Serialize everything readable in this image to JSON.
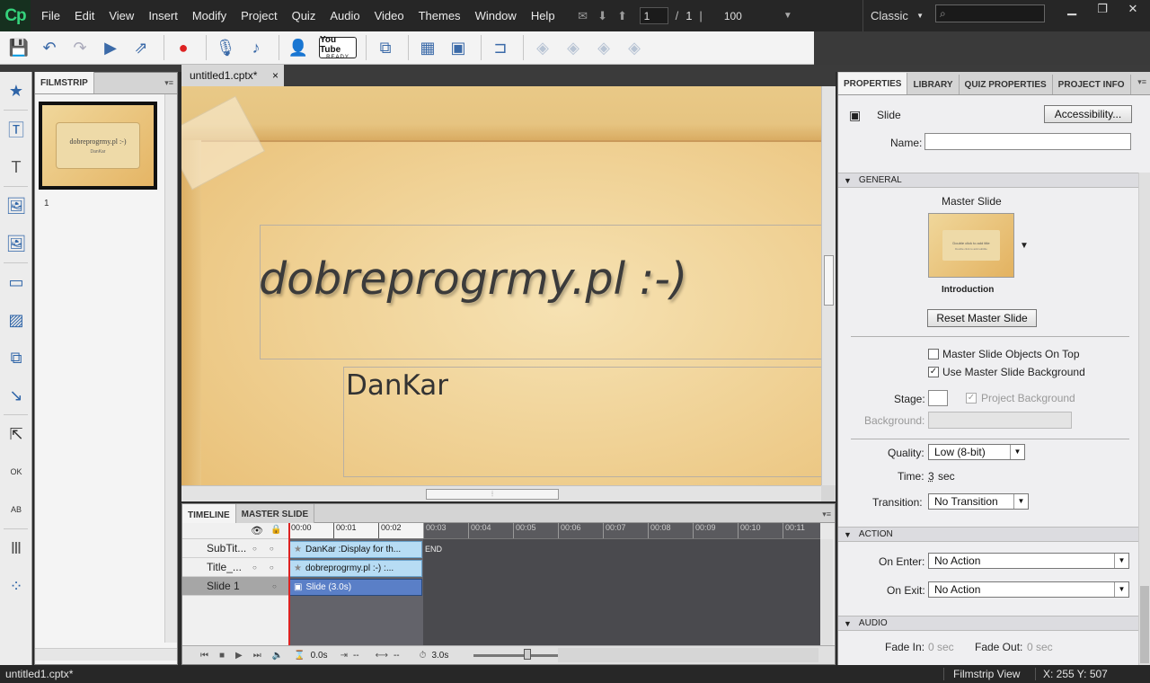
{
  "app": {
    "logo": "Cp"
  },
  "menu": [
    "File",
    "Edit",
    "View",
    "Insert",
    "Modify",
    "Project",
    "Quiz",
    "Audio",
    "Video",
    "Themes",
    "Window",
    "Help"
  ],
  "nav": {
    "current_slide": "1",
    "separator": "/",
    "total_slides": "1",
    "zoom": "100"
  },
  "workspace": {
    "label": "Classic"
  },
  "search": {
    "placeholder": ""
  },
  "toolbar": {
    "youtube_line1": "You Tube",
    "youtube_line2": "READY"
  },
  "filmstrip": {
    "tab": "FILMSTRIP",
    "thumb_title": "dobreprogrmy.pl :-)",
    "thumb_sub": "DanKar",
    "slide_number": "1"
  },
  "document": {
    "tab_title": "untitled1.cptx*",
    "close": "×"
  },
  "slide": {
    "title": "dobreprogrmy.pl :-)",
    "subtitle": "DanKar"
  },
  "timeline": {
    "tabs": [
      "TIMELINE",
      "MASTER SLIDE"
    ],
    "rows": [
      {
        "label": "SubTit...",
        "bar": "DanKar :Display for th..."
      },
      {
        "label": "Title_...",
        "bar": "dobreprogrmy.pl :-) :..."
      },
      {
        "label": "Slide 1",
        "bar": "Slide (3.0s)"
      }
    ],
    "ticks": [
      "00:00",
      "00:01",
      "00:02",
      "00:03",
      "00:04",
      "00:05",
      "00:06",
      "00:07",
      "00:08",
      "00:09",
      "00:10",
      "00:11"
    ],
    "end_label": "END",
    "current_time": "0.0s",
    "start": "--",
    "duration_field": "--",
    "total_time": "3.0s"
  },
  "properties": {
    "tabs": [
      "PROPERTIES",
      "LIBRARY",
      "QUIZ PROPERTIES",
      "PROJECT INFO"
    ],
    "object_type": "Slide",
    "accessibility_button": "Accessibility...",
    "name_label": "Name:",
    "name_value": "",
    "general": {
      "header": "GENERAL",
      "master_slide_label": "Master Slide",
      "master_thumb_text": "Double click to add title",
      "master_thumb_sub": "Double click to add subtitle",
      "master_name": "Introduction",
      "reset_button": "Reset Master Slide",
      "objects_on_top": "Master Slide Objects On Top",
      "use_background": "Use Master Slide Background",
      "stage_label": "Stage:",
      "project_background": "Project Background",
      "background_label": "Background:",
      "quality_label": "Quality:",
      "quality_value": "Low (8-bit)",
      "time_label": "Time:",
      "time_value": "3",
      "time_unit": "sec",
      "transition_label": "Transition:",
      "transition_value": "No Transition"
    },
    "action": {
      "header": "ACTION",
      "on_enter_label": "On Enter:",
      "on_enter_value": "No Action",
      "on_exit_label": "On Exit:",
      "on_exit_value": "No Action"
    },
    "audio": {
      "header": "AUDIO",
      "fade_in_label": "Fade In:",
      "fade_in_value": "0 sec",
      "fade_out_label": "Fade Out:",
      "fade_out_value": "0 sec"
    }
  },
  "status": {
    "file": "untitled1.cptx*",
    "view": "Filmstrip View",
    "coords": "X: 255 Y: 507"
  },
  "colors": {
    "accent": "#35d37c",
    "timeline_slide_bar": "#5a7fc7",
    "timeline_object_bar": "#b7dcf4",
    "playhead": "#dd2222"
  }
}
